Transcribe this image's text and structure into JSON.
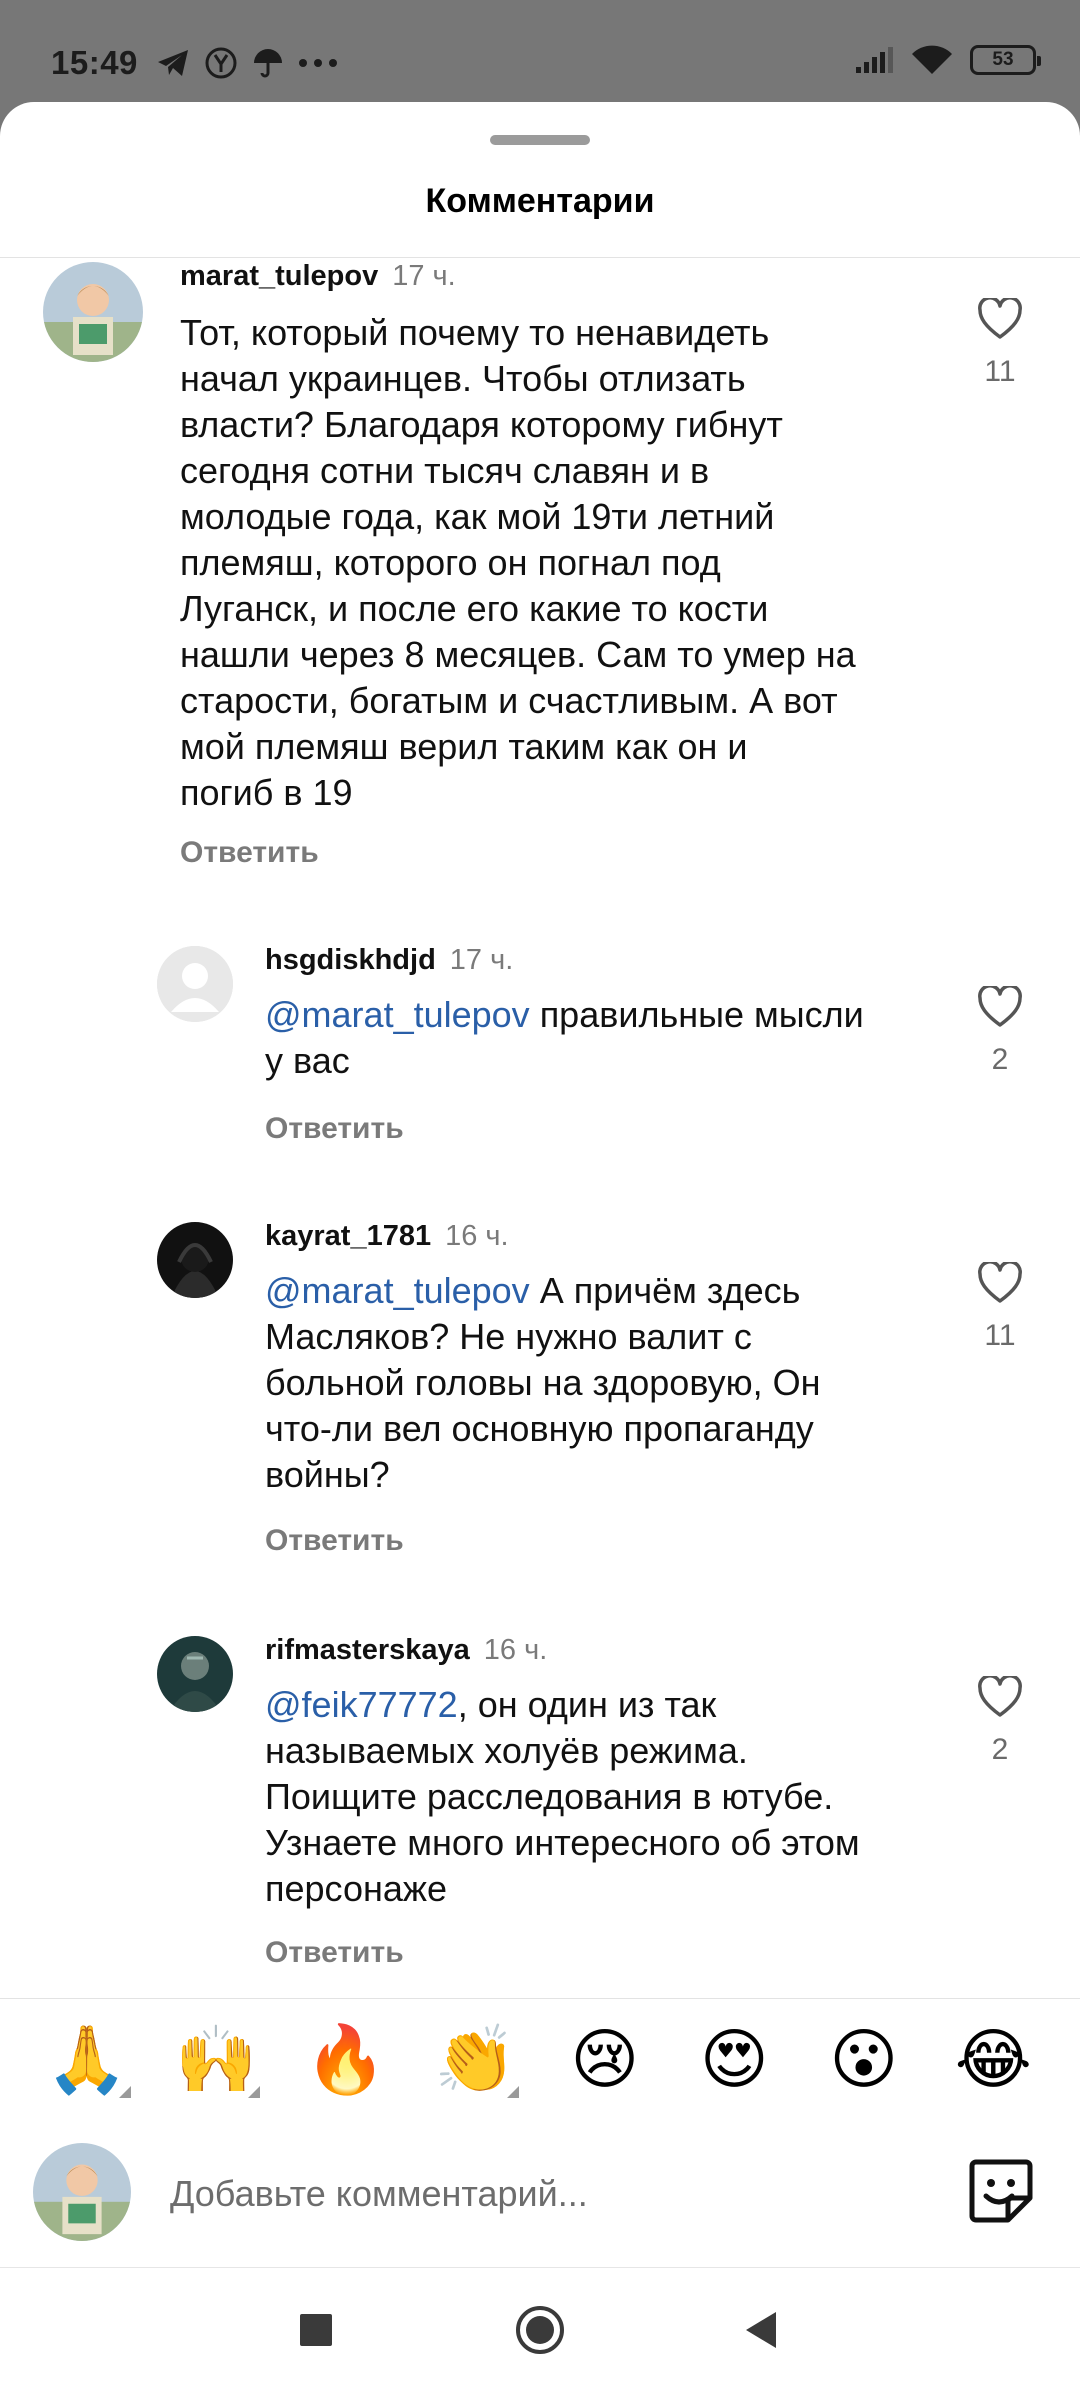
{
  "status_bar": {
    "time": "15:49",
    "battery": "53",
    "left_icons": [
      "telegram-icon",
      "yandex-icon",
      "umbrella-icon",
      "more-dots-icon"
    ],
    "right_icons": [
      "signal-icon",
      "wifi-icon",
      "battery-icon"
    ]
  },
  "sheet": {
    "title": "Комментарии"
  },
  "comments": [
    {
      "username": "marat_tulepov",
      "time": "17 ч.",
      "mention": "",
      "text_lines": [
        "Тот, который почему то ненавидеть",
        "начал украинцев. Чтобы отлизать",
        "власти? Благодаря которому гибнут",
        "сегодня сотни тысяч славян и в",
        "молодые года, как мой 19ти летний",
        "племяш, которого он погнал под",
        "Луганск, и после его какие то кости",
        "нашли через 8 месяцев. Сам то умер на",
        "старости, богатым и счастливым. А вот",
        "мой племяш верил таким как он и",
        "погиб в 19"
      ],
      "reply_label": "Ответить",
      "likes": "11"
    },
    {
      "username": "hsgdiskhdjd",
      "time": "17 ч.",
      "mention": "@marat_tulepov",
      "text_lines": [
        " правильные мысли",
        "у вас"
      ],
      "reply_label": "Ответить",
      "likes": "2"
    },
    {
      "username": "kayrat_1781",
      "time": "16 ч.",
      "mention": "@marat_tulepov",
      "text_lines": [
        " А причём здесь",
        "Масляков? Не нужно валит с",
        "больной головы на здоровую, Он",
        "что-ли вел основную пропаганду",
        "войны?"
      ],
      "reply_label": "Ответить",
      "likes": "11"
    },
    {
      "username": "rifmasterskaya",
      "time": "16 ч.",
      "mention": "@feik77772",
      "text_lines": [
        ", он один из так",
        "называемых холуёв режима.",
        "Поищите расследования в ютубе.",
        "Узнаете много интересного об этом",
        "персонаже"
      ],
      "reply_label": "Ответить",
      "likes": "2"
    }
  ],
  "emoji_bar": [
    "🙏",
    "🙌",
    "🔥",
    "👏",
    "😢",
    "😍",
    "😮",
    "😂"
  ],
  "comment_input": {
    "placeholder": "Добавьте комментарий..."
  },
  "nav": [
    "recents-button",
    "home-button",
    "back-button"
  ],
  "colors": {
    "mention": "#2a5fa8",
    "secondary_text": "#7a7a7a",
    "status_bar_bg": "#777777"
  }
}
